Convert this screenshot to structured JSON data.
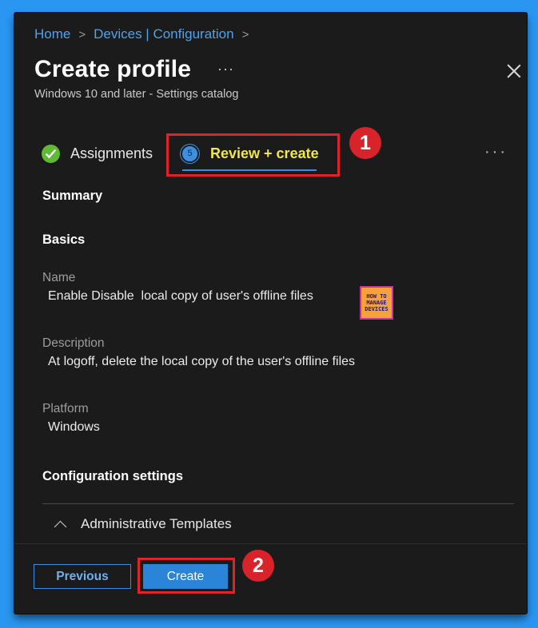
{
  "breadcrumb": {
    "items": [
      "Home",
      "Devices | Configuration"
    ],
    "separator": ">"
  },
  "header": {
    "title": "Create profile",
    "more_label": "···",
    "subtitle": "Windows 10 and later - Settings catalog",
    "close_icon": "close-icon"
  },
  "tabs": {
    "assignments": {
      "label": "Assignments",
      "icon": "check-circle-icon"
    },
    "review": {
      "label": "Review + create",
      "step_number": "5"
    },
    "more_label": "···"
  },
  "summary": {
    "heading": "Summary",
    "basics_heading": "Basics",
    "name_label": "Name",
    "name_value": "Enable Disable  local copy of user's offline files",
    "description_label": "Description",
    "description_value": "At logoff, delete the local copy of the user's offline files",
    "platform_label": "Platform",
    "platform_value": "Windows",
    "config_heading": "Configuration settings",
    "admin_templates_label": "Administrative Templates"
  },
  "watermark": {
    "line1": "HOW TO",
    "line2": "MANAGE",
    "line3": "DEVICES"
  },
  "annotations": {
    "badge1": "1",
    "badge2": "2",
    "highlight_color": "#e0232b"
  },
  "footer": {
    "previous_label": "Previous",
    "create_label": "Create"
  },
  "colors": {
    "background_frame": "#2a96f1",
    "panel": "#1b1b1b",
    "accent": "#3a8de3",
    "active_tab_text": "#f2e64d",
    "success": "#5fb932"
  }
}
